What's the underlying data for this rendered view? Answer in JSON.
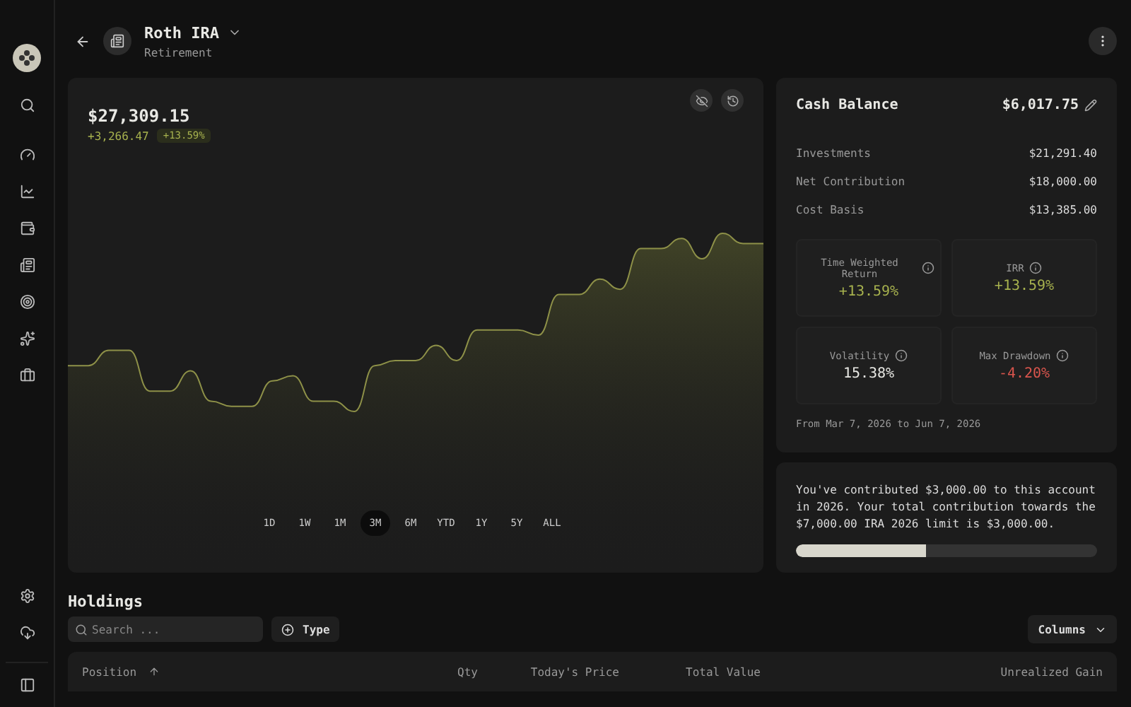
{
  "account": {
    "name": "Roth IRA",
    "type": "Retirement"
  },
  "chart": {
    "value": "$27,309.15",
    "change": "+3,266.47",
    "change_pct": "+13.59%",
    "ranges": [
      {
        "label": "1D",
        "selected": false
      },
      {
        "label": "1W",
        "selected": false
      },
      {
        "label": "1M",
        "selected": false
      },
      {
        "label": "3M",
        "selected": true
      },
      {
        "label": "6M",
        "selected": false
      },
      {
        "label": "YTD",
        "selected": false
      },
      {
        "label": "1Y",
        "selected": false
      },
      {
        "label": "5Y",
        "selected": false
      },
      {
        "label": "ALL",
        "selected": false
      }
    ]
  },
  "summary": {
    "title": "Cash Balance",
    "cash": "$6,017.75",
    "rows": [
      {
        "label": "Investments",
        "value": "$21,291.40"
      },
      {
        "label": "Net Contribution",
        "value": "$18,000.00"
      },
      {
        "label": "Cost Basis",
        "value": "$13,385.00"
      }
    ],
    "metrics": [
      {
        "label": "Time Weighted Return",
        "value": "+13.59%",
        "color": "#a7b24e"
      },
      {
        "label": "IRR",
        "value": "+13.59%",
        "color": "#a7b24e"
      },
      {
        "label": "Volatility",
        "value": "15.38%",
        "color": "#e8e8e4"
      },
      {
        "label": "Max Drawdown",
        "value": "-4.20%",
        "color": "#d9554d"
      }
    ],
    "period": "From Mar 7, 2026 to Jun 7, 2026"
  },
  "contribution": {
    "text": "You've contributed $3,000.00 to this account in 2026. Your total contribution towards the $7,000.00 IRA 2026 limit is $3,000.00.",
    "level": 0.43
  },
  "holdings": {
    "title": "Holdings",
    "search_placeholder": "Search ...",
    "filter": "Type",
    "columns_button": "Columns",
    "columns": [
      "Position",
      "Qty",
      "Today's Price",
      "Total Value",
      "Unrealized Gain"
    ]
  }
}
